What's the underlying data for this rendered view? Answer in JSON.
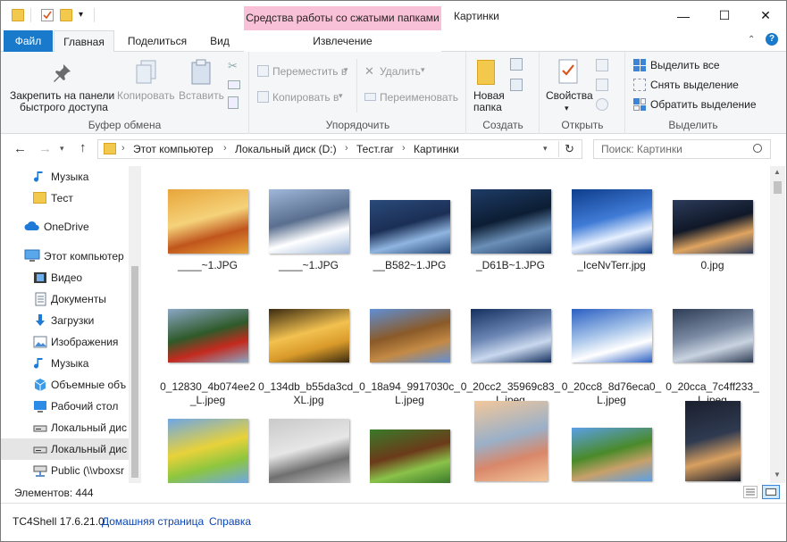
{
  "window": {
    "title": "Картинки",
    "context_tab_header": "Средства работы со сжатыми папками",
    "minimize": "—",
    "maximize": "☐",
    "close": "✕"
  },
  "tabs": [
    {
      "label": "Файл"
    },
    {
      "label": "Главная"
    },
    {
      "label": "Поделиться"
    },
    {
      "label": "Вид"
    },
    {
      "label": "Извлечение"
    }
  ],
  "ribbon": {
    "clipboard": {
      "label": "Буфер обмена",
      "pin_line1": "Закрепить на панели",
      "pin_line2": "быстрого доступа",
      "copy": "Копировать",
      "paste": "Вставить"
    },
    "organize": {
      "label": "Упорядочить",
      "move_to": "Переместить в",
      "copy_to": "Копировать в",
      "delete": "Удалить",
      "rename": "Переименовать"
    },
    "create": {
      "label": "Создать",
      "new_folder_line1": "Новая",
      "new_folder_line2": "папка"
    },
    "open": {
      "label": "Открыть",
      "properties": "Свойства"
    },
    "select": {
      "label": "Выделить",
      "select_all": "Выделить все",
      "select_none": "Снять выделение",
      "invert": "Обратить выделение"
    }
  },
  "nav": {
    "breadcrumbs": [
      "Этот компьютер",
      "Локальный диск (D:)",
      "Тест.rar",
      "Картинки"
    ],
    "search_placeholder": "Поиск: Картинки"
  },
  "sidebar": {
    "items": [
      {
        "label": "Музыка",
        "icon": "music-icon"
      },
      {
        "label": "Тест",
        "icon": "folder-icon"
      },
      {
        "label": "OneDrive",
        "icon": "cloud-icon"
      },
      {
        "label": "Этот компьютер",
        "icon": "computer-icon"
      },
      {
        "label": "Видео",
        "icon": "video-icon"
      },
      {
        "label": "Документы",
        "icon": "documents-icon"
      },
      {
        "label": "Загрузки",
        "icon": "download-icon"
      },
      {
        "label": "Изображения",
        "icon": "pictures-icon"
      },
      {
        "label": "Музыка",
        "icon": "music-icon"
      },
      {
        "label": "Объемные объ",
        "icon": "3d-objects-icon"
      },
      {
        "label": "Рабочий стол",
        "icon": "desktop-icon"
      },
      {
        "label": "Локальный дис",
        "icon": "drive-icon"
      },
      {
        "label": "Локальный дис",
        "icon": "drive-icon"
      },
      {
        "label": "Public (\\\\vboxsr",
        "icon": "network-drive-icon"
      }
    ]
  },
  "files": [
    {
      "name": "____~1.JPG",
      "colors": [
        "#e8a53a",
        "#c0551c",
        "#f5d27a"
      ]
    },
    {
      "name": "____~1.JPG",
      "colors": [
        "#9fb7d9",
        "#ffffff",
        "#5a6f8f"
      ]
    },
    {
      "name": "__B582~1.JPG",
      "colors": [
        "#2a4a7a",
        "#8fb5e0",
        "#1b2f55"
      ]
    },
    {
      "name": "_D61B~1.JPG",
      "colors": [
        "#1e3c66",
        "#6b8fb7",
        "#0c1d33"
      ]
    },
    {
      "name": "_IceNvTerr.jpg",
      "colors": [
        "#0e3d8c",
        "#e6f0ff",
        "#3f7bd6"
      ]
    },
    {
      "name": "0.jpg",
      "colors": [
        "#2c3b5a",
        "#e0a460",
        "#101828"
      ]
    },
    {
      "name": "0_12830_4b074ee2_L.jpeg",
      "colors": [
        "#8aa7c5",
        "#c42a1e",
        "#2f5a2a"
      ]
    },
    {
      "name": "0_134db_b55da3cd_XL.jpg",
      "colors": [
        "#3a2a10",
        "#d99a2a",
        "#f2c150"
      ]
    },
    {
      "name": "0_18a94_9917030c_L.jpeg",
      "colors": [
        "#5f8fd6",
        "#c48a45",
        "#8a5a28"
      ]
    },
    {
      "name": "0_20cc2_35969c83_L.jpeg",
      "colors": [
        "#14305e",
        "#c9d8ee",
        "#6d87b5"
      ]
    },
    {
      "name": "0_20cc8_8d76eca0_L.jpeg",
      "colors": [
        "#2a5fc2",
        "#ffffff",
        "#a9c6ea"
      ]
    },
    {
      "name": "0_20cca_7c4ff233_L.jpeg",
      "colors": [
        "#2e3c55",
        "#c9d3e0",
        "#7a8aa3"
      ]
    },
    {
      "name": "",
      "colors": [
        "#6ea6e6",
        "#8dc63f",
        "#e8d23a"
      ]
    },
    {
      "name": "",
      "colors": [
        "#c9c9c9",
        "#6f6f6f",
        "#e6e6e6"
      ]
    },
    {
      "name": "",
      "colors": [
        "#3a7a2a",
        "#8ac24a",
        "#6b3a1a"
      ]
    },
    {
      "name": "",
      "colors": [
        "#f2c79a",
        "#d9876a",
        "#9ab0c8"
      ]
    },
    {
      "name": "",
      "colors": [
        "#5aa0e6",
        "#c8a06a",
        "#4a8a2a"
      ]
    },
    {
      "name": "",
      "colors": [
        "#1a1f2e",
        "#d9a060",
        "#2f3a50"
      ]
    }
  ],
  "status": {
    "items_count": "Элементов: 444"
  },
  "tc4shell": {
    "version": "TC4Shell 17.6.21.0",
    "homepage": "Домашняя страница",
    "help": "Справка"
  },
  "colors": {
    "accent": "#1979ca",
    "context_tab": "#f9c1d7",
    "selection": "#cce8ff"
  }
}
